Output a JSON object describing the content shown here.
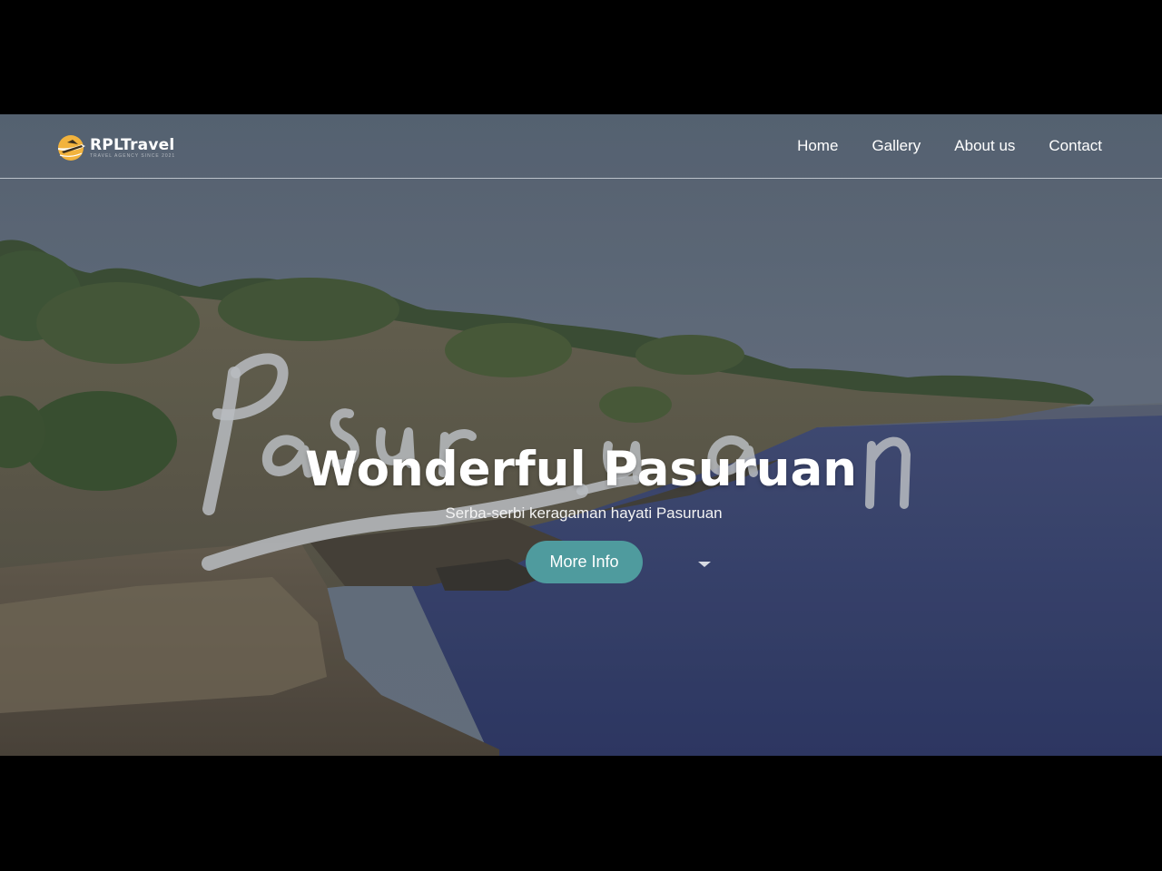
{
  "brand": {
    "name": "RPLTravel",
    "tagline": "TRAVEL AGENCY SINCE 2021",
    "logo_icon": "airplane-sun-logo-icon",
    "accent_color": "#f2b33d"
  },
  "nav": {
    "items": [
      {
        "label": "Home"
      },
      {
        "label": "Gallery"
      },
      {
        "label": "About us"
      },
      {
        "label": "Contact"
      }
    ]
  },
  "hero": {
    "script_word": "Pasuruan",
    "title": "Wonderful Pasuruan",
    "subtitle": "Serba-serbi keragaman hayati Pasuruan",
    "button_label": "More Info",
    "button_color": "#4f9b9e"
  }
}
